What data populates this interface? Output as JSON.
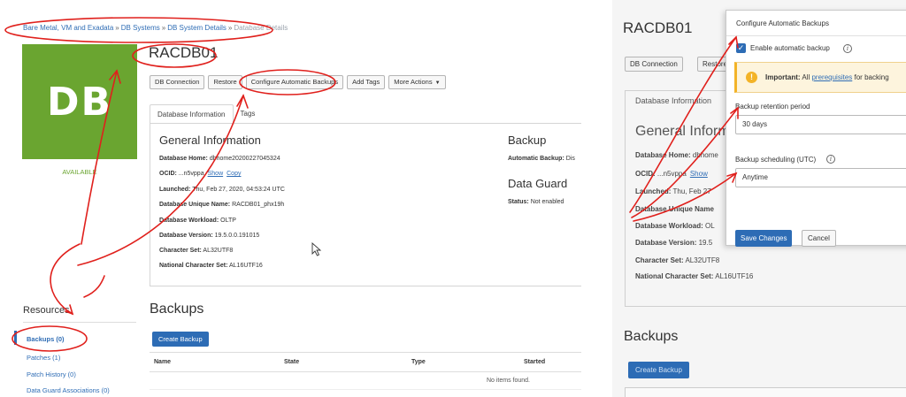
{
  "left": {
    "breadcrumb": {
      "items": [
        "Bare Metal, VM and Exadata",
        "DB Systems",
        "DB System Details"
      ],
      "separator": "»",
      "current": "Database Details"
    },
    "tile": {
      "text": "DB",
      "status": "AVAILABLE",
      "color": "#6aa530"
    },
    "title": "RACDB01",
    "buttons": {
      "db_connection": "DB Connection",
      "restore": "Restore",
      "configure_backups": "Configure Automatic Backups",
      "add_tags": "Add Tags",
      "more_actions": "More Actions"
    },
    "tabs": {
      "database_information": "Database Information",
      "tags": "Tags"
    },
    "general": {
      "title": "General Information",
      "rows": [
        {
          "label": "Database Home:",
          "value": "dbhome20200227045324"
        },
        {
          "label": "OCID:",
          "value": "...n5vppa",
          "show": "Show",
          "copy": "Copy"
        },
        {
          "label": "Launched:",
          "value": "Thu, Feb 27, 2020, 04:53:24 UTC"
        },
        {
          "label": "Database Unique Name:",
          "value": "RACDB01_phx19h"
        },
        {
          "label": "Database Workload:",
          "value": "OLTP"
        },
        {
          "label": "Database Version:",
          "value": "19.5.0.0.191015"
        },
        {
          "label": "Character Set:",
          "value": "AL32UTF8"
        },
        {
          "label": "National Character Set:",
          "value": "AL16UTF16"
        }
      ]
    },
    "backup": {
      "title": "Backup",
      "label": "Automatic Backup:",
      "value": "Dis"
    },
    "dataguard": {
      "title": "Data Guard",
      "label": "Status:",
      "value": "Not enabled"
    },
    "resources": {
      "title": "Resources",
      "items": [
        "Backups (0)",
        "Patches (1)",
        "Patch History (0)",
        "Data Guard Associations (0)"
      ]
    },
    "backups": {
      "title": "Backups",
      "create": "Create Backup",
      "columns": [
        "Name",
        "State",
        "Type",
        "Started"
      ],
      "empty": "No items found."
    }
  },
  "right": {
    "title": "RACDB01",
    "buttons": {
      "db_connection": "DB Connection",
      "restore": "Restore"
    },
    "tab": "Database Information",
    "general_title": "General Inform",
    "rows": [
      {
        "label": "Database Home:",
        "value": "dbhome"
      },
      {
        "label": "OCID:",
        "value": "...n5vppa",
        "show": "Show"
      },
      {
        "label": "Launched:",
        "value": "Thu, Feb 27"
      },
      {
        "label": "Database Unique Name",
        "value": ""
      },
      {
        "label": "Database Workload:",
        "value": "OL"
      },
      {
        "label": "Database Version:",
        "value": "19.5"
      },
      {
        "label": "Character Set:",
        "value": "AL32UTF8"
      },
      {
        "label": "National Character Set:",
        "value": "AL16UTF16"
      }
    ],
    "backups_title": "Backups",
    "create": "Create Backup",
    "dialog": {
      "title": "Configure Automatic Backups",
      "enable_label": "Enable automatic backup",
      "warning": {
        "strong": "Important:",
        "text": " All ",
        "link": "prerequisites",
        "rest": " for backing"
      },
      "retention_label": "Backup retention period",
      "retention_value": "30 days",
      "schedule_label": "Backup scheduling (UTC)",
      "schedule_value": "Anytime",
      "save": "Save Changes",
      "cancel": "Cancel"
    }
  },
  "colors": {
    "accent": "#2d6cb5",
    "tile": "#6aa530",
    "annotation": "#e0201c",
    "warning": "#f3b327"
  }
}
